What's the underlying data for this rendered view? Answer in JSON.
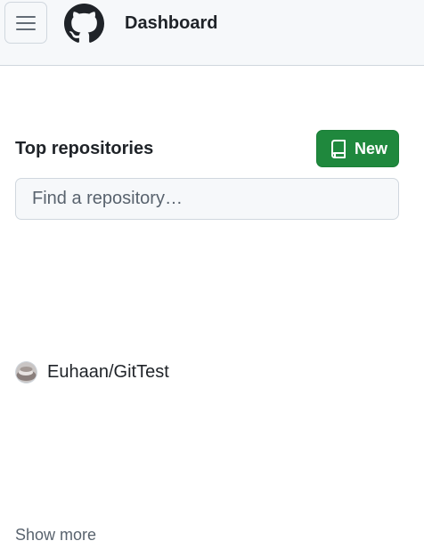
{
  "header": {
    "title": "Dashboard",
    "menu_icon": "hamburger-icon",
    "logo_icon": "github-logo-icon"
  },
  "repositories": {
    "title": "Top repositories",
    "new_button": {
      "label": "New",
      "icon": "repo-icon"
    },
    "search": {
      "placeholder": "Find a repository…",
      "value": ""
    },
    "items": [
      {
        "name": "Euhaan/GitTest",
        "icon": "avatar"
      }
    ],
    "show_more_label": "Show more"
  },
  "colors": {
    "header_bg": "#f6f8fa",
    "border": "#d0d7de",
    "primary_button": "#1f883d",
    "text": "#1f2328",
    "muted_text": "#59636e"
  }
}
